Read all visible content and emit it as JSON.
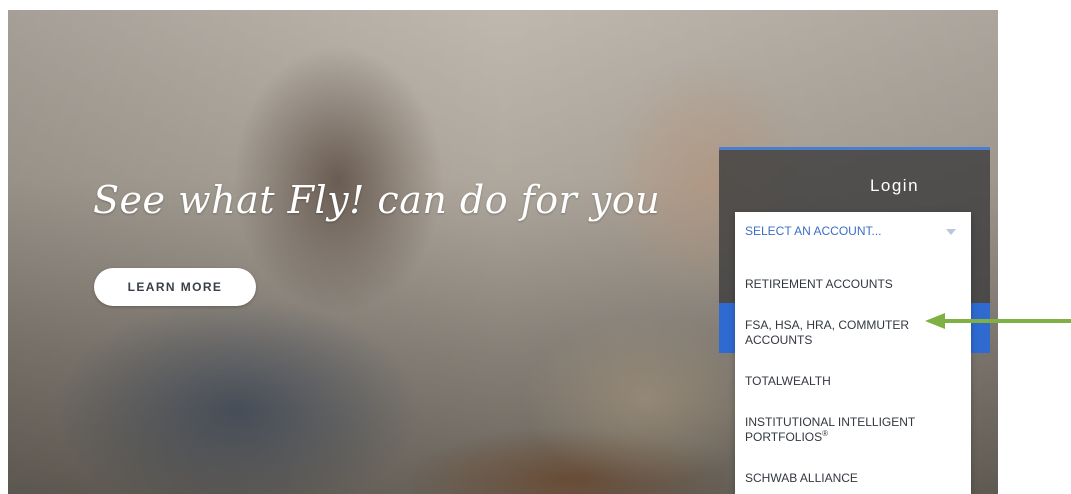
{
  "hero": {
    "headline": "See what Fly! can do for you",
    "learn_more_label": "LEARN MORE"
  },
  "login": {
    "title": "Login"
  },
  "dropdown": {
    "selected": "SELECT AN ACCOUNT...",
    "items": [
      "RETIREMENT ACCOUNTS",
      "FSA, HSA, HRA, COMMUTER ACCOUNTS",
      "TOTALWEALTH",
      "INSTITUTIONAL INTELLIGENT PORTFOLIOS",
      "SCHWAB ALLIANCE"
    ],
    "registered_mark": "®"
  },
  "colors": {
    "accent_blue": "#2f6ad0",
    "select_text": "#3a6fc7",
    "annotation_arrow": "#7fb043"
  },
  "icons": {
    "dropdown_caret": "chevron-down-icon",
    "annotation": "left-arrow-icon"
  }
}
